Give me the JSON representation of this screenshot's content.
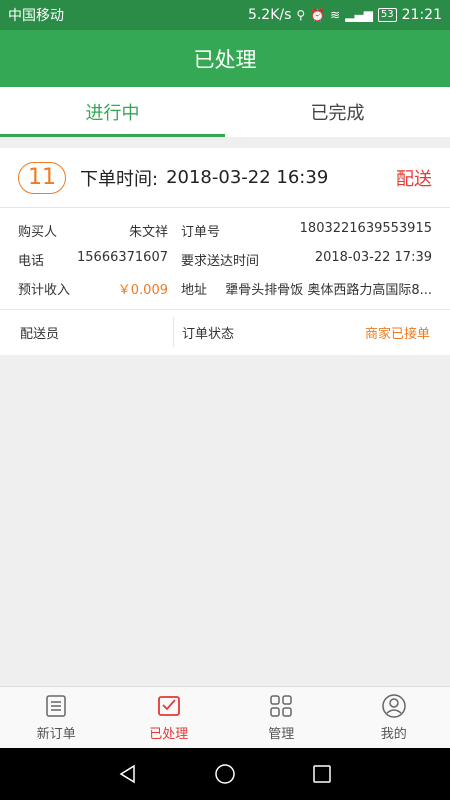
{
  "status_bar": {
    "carrier": "中国移动",
    "speed": "5.2K/s",
    "battery": "53",
    "time": "21:21"
  },
  "header": {
    "title": "已处理"
  },
  "tabs": [
    {
      "label": "进行中",
      "active": true
    },
    {
      "label": "已完成",
      "active": false
    }
  ],
  "order": {
    "number": "11",
    "time_label": "下单时间:",
    "time": "2018-03-22 16:39",
    "delivery_type": "配送",
    "buyer_label": "购买人",
    "buyer": "朱文祥",
    "order_no_label": "订单号",
    "order_no": "1803221639553915",
    "phone_label": "电话",
    "phone": "15666371607",
    "required_time_label": "要求送达时间",
    "required_time": "2018-03-22 17:39",
    "income_label": "预计收入",
    "income": "￥0.009",
    "address_label": "地址",
    "address": "犟骨头排骨饭 奥体西路力高国际8...",
    "courier_label": "配送员",
    "status_label": "订单状态",
    "status": "商家已接单"
  },
  "bottom_nav": [
    {
      "label": "新订单",
      "icon": "new-order-icon"
    },
    {
      "label": "已处理",
      "icon": "processed-icon",
      "active": true
    },
    {
      "label": "管理",
      "icon": "grid-icon"
    },
    {
      "label": "我的",
      "icon": "profile-icon"
    }
  ],
  "colors": {
    "primary": "#34a853",
    "orange": "#f07a1f",
    "red": "#e53935"
  }
}
